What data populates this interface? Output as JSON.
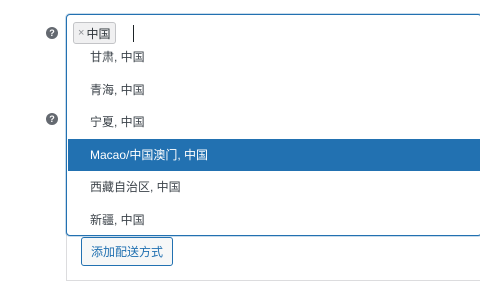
{
  "field": {
    "help_glyph": "?",
    "selected_tag": {
      "remove_glyph": "×",
      "label": "中国"
    },
    "options": [
      {
        "label": "甘肃, 中国",
        "highlighted": false
      },
      {
        "label": "青海, 中国",
        "highlighted": false
      },
      {
        "label": "宁夏, 中国",
        "highlighted": false
      },
      {
        "label": "Macao/中国澳门, 中国",
        "highlighted": true
      },
      {
        "label": "西藏自治区, 中国",
        "highlighted": false
      },
      {
        "label": "新疆, 中国",
        "highlighted": false
      }
    ]
  },
  "actions": {
    "add_shipping_method": "添加配送方式"
  },
  "colors": {
    "accent": "#2271b1",
    "help_icon": "#646970",
    "token_bg": "#f0f0f1"
  }
}
